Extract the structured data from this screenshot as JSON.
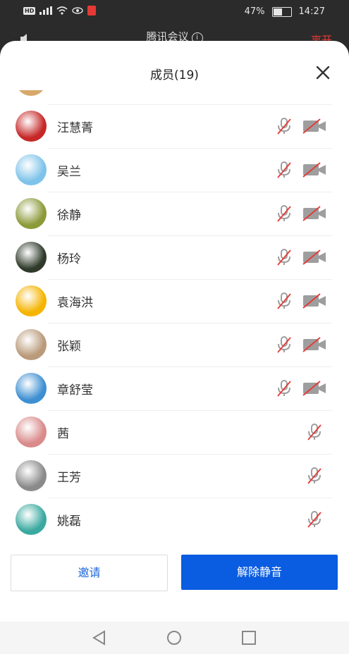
{
  "status_bar": {
    "left_icons": [
      "hd-icon",
      "signal-4g-icon",
      "wifi-icon",
      "eye-icon",
      "mic-recording-icon"
    ],
    "battery": "47%",
    "time": "14:27"
  },
  "meeting_header": {
    "title": "腾讯会议",
    "leave_label": "离开"
  },
  "sheet": {
    "title": "成员(19)"
  },
  "members": [
    {
      "name": "汪慧菁",
      "mic": "muted",
      "camera": "off",
      "avatar_color": "#c62828"
    },
    {
      "name": "吴兰",
      "mic": "muted",
      "camera": "off",
      "avatar_color": "#7ec3ea"
    },
    {
      "name": "徐静",
      "mic": "muted",
      "camera": "off",
      "avatar_color": "#8c9a3a"
    },
    {
      "name": "杨玲",
      "mic": "muted",
      "camera": "off",
      "avatar_color": "#2f3a2a"
    },
    {
      "name": "袁海洪",
      "mic": "muted",
      "camera": "off",
      "avatar_color": "#f5b400"
    },
    {
      "name": "张颖",
      "mic": "muted",
      "camera": "off",
      "avatar_color": "#b99a7a"
    },
    {
      "name": "章舒莹",
      "mic": "muted",
      "camera": "off",
      "avatar_color": "#3d8fd1"
    },
    {
      "name": "茜",
      "mic": "muted",
      "camera": null,
      "avatar_color": "#d98a8a"
    },
    {
      "name": "王芳",
      "mic": "muted",
      "camera": null,
      "avatar_color": "#8a8a8a"
    },
    {
      "name": "姚磊",
      "mic": "muted",
      "camera": null,
      "avatar_color": "#3aa9a0"
    }
  ],
  "actions": {
    "invite_label": "邀请",
    "unmute_all_label": "解除静音"
  },
  "nav": [
    "back-icon",
    "home-icon",
    "recents-icon"
  ],
  "colors": {
    "primary": "#0a5ce0",
    "invite_text": "#1a66d6",
    "muted_slash": "#e53935",
    "icon_gray": "#9e9e9e"
  }
}
